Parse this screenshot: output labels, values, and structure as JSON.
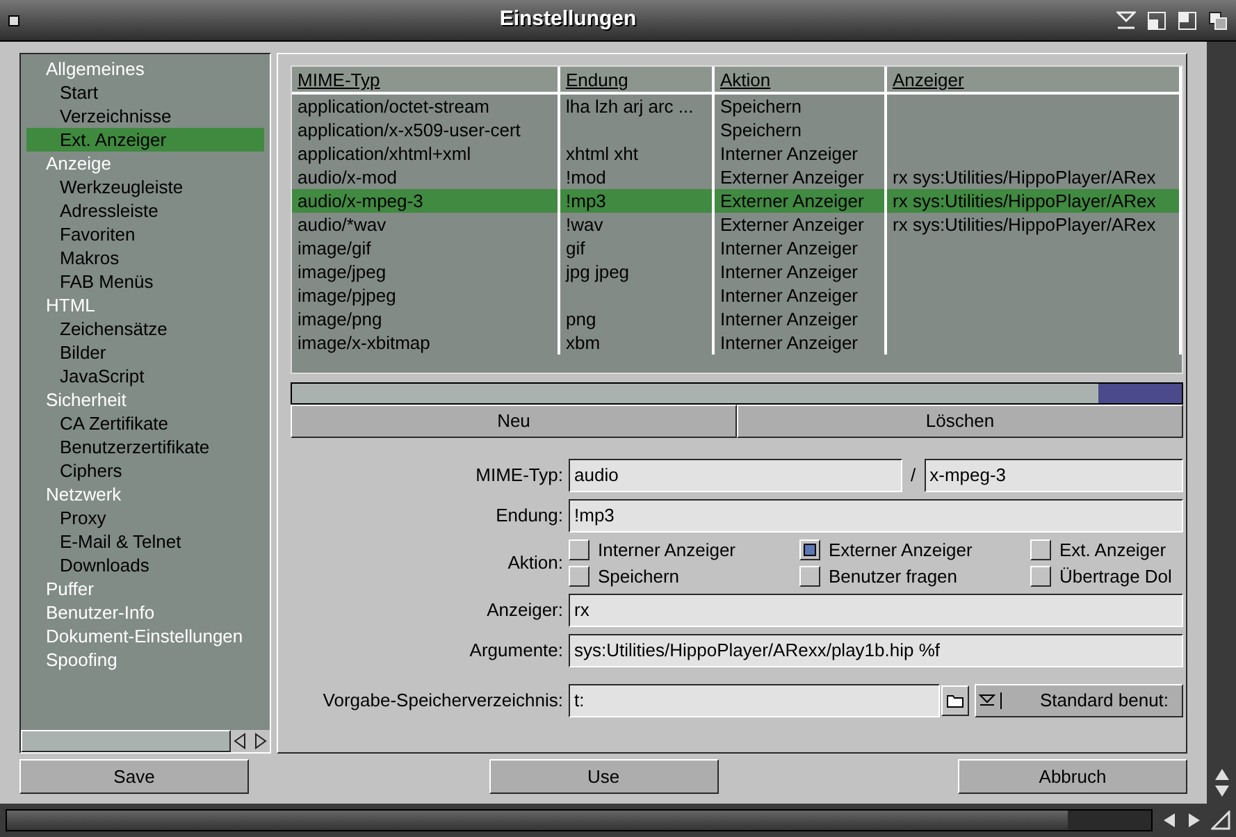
{
  "window": {
    "title": "Einstellungen"
  },
  "sidebar": {
    "items": [
      {
        "label": "Allgemeines",
        "selected": false,
        "children": [
          {
            "label": "Start",
            "selected": false
          },
          {
            "label": "Verzeichnisse",
            "selected": false
          },
          {
            "label": "Ext. Anzeiger",
            "selected": true
          }
        ]
      },
      {
        "label": "Anzeige",
        "selected": false,
        "children": [
          {
            "label": "Werkzeugleiste",
            "selected": false
          },
          {
            "label": "Adressleiste",
            "selected": false
          },
          {
            "label": "Favoriten",
            "selected": false
          },
          {
            "label": "Makros",
            "selected": false
          },
          {
            "label": "FAB Menüs",
            "selected": false
          }
        ]
      },
      {
        "label": "HTML",
        "selected": false,
        "children": [
          {
            "label": "Zeichensätze",
            "selected": false
          },
          {
            "label": "Bilder",
            "selected": false
          },
          {
            "label": "JavaScript",
            "selected": false
          }
        ]
      },
      {
        "label": "Sicherheit",
        "selected": false,
        "children": [
          {
            "label": "CA Zertifikate",
            "selected": false
          },
          {
            "label": "Benutzerzertifikate",
            "selected": false
          },
          {
            "label": "Ciphers",
            "selected": false
          }
        ]
      },
      {
        "label": "Netzwerk",
        "selected": false,
        "children": [
          {
            "label": "Proxy",
            "selected": false
          },
          {
            "label": "E-Mail & Telnet",
            "selected": false
          },
          {
            "label": "Downloads",
            "selected": false
          }
        ]
      },
      {
        "label": "Puffer",
        "selected": false
      },
      {
        "label": "Benutzer-Info",
        "selected": false
      },
      {
        "label": "Dokument-Einstellungen",
        "selected": false
      },
      {
        "label": "Spoofing",
        "selected": false
      }
    ]
  },
  "table": {
    "columns": [
      "MIME-Typ",
      "Endung",
      "Aktion",
      "Anzeiger"
    ],
    "rows": [
      {
        "cells": [
          "application/octet-stream",
          "lha lzh arj arc ...",
          "Speichern",
          ""
        ],
        "selected": false
      },
      {
        "cells": [
          "application/x-x509-user-cert",
          "",
          "Speichern",
          ""
        ],
        "selected": false
      },
      {
        "cells": [
          "application/xhtml+xml",
          "xhtml xht",
          "Interner Anzeiger",
          ""
        ],
        "selected": false
      },
      {
        "cells": [
          "audio/x-mod",
          "!mod",
          "Externer Anzeiger",
          "rx sys:Utilities/HippoPlayer/ARex"
        ],
        "selected": false
      },
      {
        "cells": [
          "audio/x-mpeg-3",
          "!mp3",
          "Externer Anzeiger",
          "rx sys:Utilities/HippoPlayer/ARex"
        ],
        "selected": true
      },
      {
        "cells": [
          "audio/*wav",
          "!wav",
          "Externer Anzeiger",
          "rx sys:Utilities/HippoPlayer/ARex"
        ],
        "selected": false
      },
      {
        "cells": [
          "image/gif",
          "gif",
          "Interner Anzeiger",
          ""
        ],
        "selected": false
      },
      {
        "cells": [
          "image/jpeg",
          "jpg jpeg",
          "Interner Anzeiger",
          ""
        ],
        "selected": false
      },
      {
        "cells": [
          "image/pjpeg",
          "",
          "Interner Anzeiger",
          ""
        ],
        "selected": false
      },
      {
        "cells": [
          "image/png",
          "png",
          "Interner Anzeiger",
          ""
        ],
        "selected": false
      },
      {
        "cells": [
          "image/x-xbitmap",
          "xbm",
          "Interner Anzeiger",
          ""
        ],
        "selected": false
      }
    ]
  },
  "list_buttons": [
    "Neu",
    "Löschen"
  ],
  "form": {
    "mime_label": "MIME-Typ:",
    "mime_type": "audio",
    "separator": "/",
    "mime_subtype": "x-mpeg-3",
    "ext_label": "Endung:",
    "ext": "!mp3",
    "action_label": "Aktion:",
    "actions": [
      {
        "label": "Interner Anzeiger",
        "checked": false
      },
      {
        "label": "Externer Anzeiger",
        "checked": true
      },
      {
        "label": "Ext. Anzeiger",
        "checked": false
      },
      {
        "label": "Speichern",
        "checked": false
      },
      {
        "label": "Benutzer fragen",
        "checked": false
      },
      {
        "label": "Übertrage Dol",
        "checked": false
      }
    ],
    "viewer_label": "Anzeiger:",
    "viewer": "rx",
    "args_label": "Argumente:",
    "args": "sys:Utilities/HippoPlayer/ARexx/play1b.hip %f",
    "dir_label": "Vorgabe-Speicherverzeichnis:",
    "dir": "t:",
    "dir_button": "Standard benut:"
  },
  "buttons": [
    "Save",
    "Use",
    "Abbruch"
  ]
}
